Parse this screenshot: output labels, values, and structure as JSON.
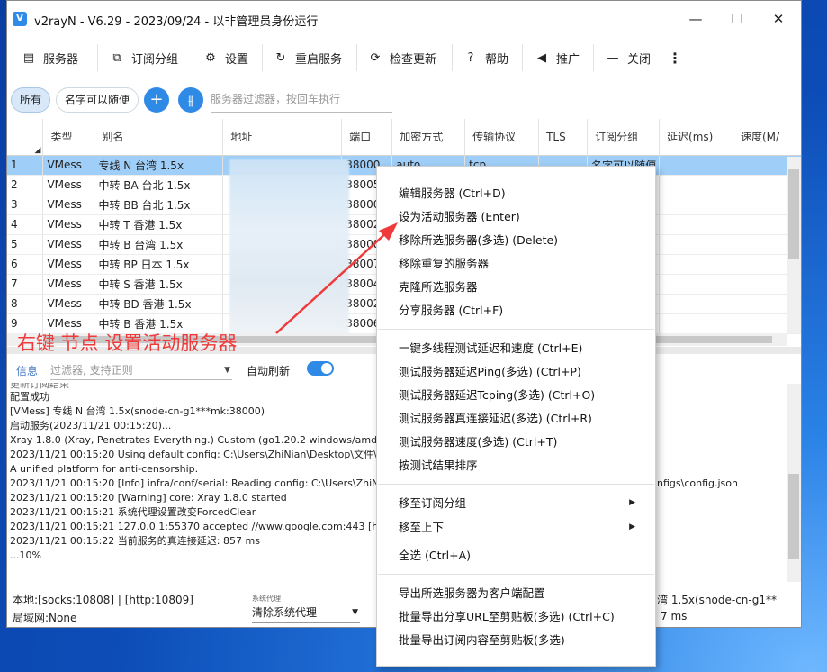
{
  "window": {
    "title": "v2rayN - V6.29 - 2023/09/24 - 以非管理员身份运行",
    "controls": [
      "—",
      "☐",
      "✕"
    ]
  },
  "toolbar": {
    "items": [
      {
        "icon": "server-icon",
        "glyph": "▤",
        "label": "服务器"
      },
      {
        "icon": "subscription-icon",
        "glyph": "⧉",
        "label": "订阅分组"
      },
      {
        "icon": "gear-icon",
        "glyph": "⚙",
        "label": "设置"
      },
      {
        "icon": "restart-icon",
        "glyph": "↻",
        "label": "重启服务"
      },
      {
        "icon": "update-icon",
        "glyph": "⟳",
        "label": "检查更新"
      },
      {
        "icon": "help-icon",
        "glyph": "?",
        "label": "帮助"
      },
      {
        "icon": "promote-icon",
        "glyph": "◀",
        "label": "推广"
      },
      {
        "icon": "close-icon",
        "glyph": "—",
        "label": "关闭"
      }
    ],
    "more": "⋮"
  },
  "filterbar": {
    "chips": [
      "所有",
      "名字可以随便"
    ],
    "search_placeholder": "服务器过滤器，按回车执行"
  },
  "grid": {
    "columns": [
      "",
      "类型",
      "别名",
      "地址",
      "端口",
      "加密方式",
      "传输协议",
      "TLS",
      "订阅分组",
      "延迟(ms)",
      "速度(M/"
    ],
    "rows": [
      {
        "n": "1",
        "type": "VMess",
        "alias": "专线 N 台湾 1.5x",
        "port": "38000",
        "security": "auto",
        "network": "tcp",
        "tls": "",
        "sub": "名字可以随便"
      },
      {
        "n": "2",
        "type": "VMess",
        "alias": "中转 BA 台北 1.5x",
        "port": "38005",
        "security": "",
        "network": "",
        "tls": "",
        "sub": ""
      },
      {
        "n": "3",
        "type": "VMess",
        "alias": "中转 BB 台北 1.5x",
        "port": "38000",
        "security": "",
        "network": "",
        "tls": "",
        "sub": ""
      },
      {
        "n": "4",
        "type": "VMess",
        "alias": "中转 T 香港 1.5x",
        "port": "38002",
        "security": "",
        "network": "",
        "tls": "",
        "sub": ""
      },
      {
        "n": "5",
        "type": "VMess",
        "alias": "中转 B 台湾 1.5x",
        "port": "38008",
        "security": "",
        "network": "",
        "tls": "",
        "sub": ""
      },
      {
        "n": "6",
        "type": "VMess",
        "alias": "中转 BP 日本 1.5x",
        "port": "38007",
        "security": "",
        "network": "",
        "tls": "",
        "sub": ""
      },
      {
        "n": "7",
        "type": "VMess",
        "alias": "中转 S 香港 1.5x",
        "port": "38004",
        "security": "",
        "network": "",
        "tls": "",
        "sub": ""
      },
      {
        "n": "8",
        "type": "VMess",
        "alias": "中转 BD 香港 1.5x",
        "port": "38002",
        "security": "",
        "network": "",
        "tls": "",
        "sub": ""
      },
      {
        "n": "9",
        "type": "VMess",
        "alias": "中转 B 香港 1.5x",
        "port": "38006",
        "security": "",
        "network": "",
        "tls": "",
        "sub": ""
      }
    ]
  },
  "log": {
    "tab": "信息",
    "filter_placeholder": "过滤器, 支持正则",
    "auto_refresh": "自动刷新",
    "cut_line": "更新订阅结束",
    "lines": [
      "配置成功",
      "[VMess] 专线 N 台湾 1.5x(snode-cn-g1***mk:38000)",
      "启动服务(2023/11/21 00:15:20)...",
      "Xray 1.8.0 (Xray, Penetrates Everything.) Custom (go1.20.2 windows/amd64)",
      "2023/11/21 00:15:20 Using default config:  C:\\Users\\ZhiNian\\Desktop\\文件\\v2r",
      "A unified platform for anti-censorship.",
      "2023/11/21 00:15:20 [Info] infra/conf/serial: Reading config: C:\\Users\\ZhiNian\\",
      "2023/11/21 00:15:20 [Warning] core: Xray 1.8.0 started",
      "2023/11/21 00:15:21 系统代理设置改变ForcedClear",
      "2023/11/21 00:15:21 127.0.0.1:55370 accepted //www.google.com:443 [http >>",
      "2023/11/21 00:15:22 当前服务的真连接延迟: 857 ms",
      "...10%"
    ],
    "tail_text": "nfigs\\config.json"
  },
  "status": {
    "local": "本地:[socks:10808] | [http:10809]",
    "lan": "局域网:None",
    "proxy_label": "系统代理",
    "proxy_value": "清除系统代理",
    "server_tail": "湾 1.5x(snode-cn-g1**",
    "delay_tail": "7 ms"
  },
  "context_menu": {
    "group1": [
      "编辑服务器 (Ctrl+D)",
      "设为活动服务器 (Enter)",
      "移除所选服务器(多选) (Delete)",
      "移除重复的服务器",
      "克隆所选服务器",
      "分享服务器 (Ctrl+F)"
    ],
    "group2": [
      "一键多线程测试延迟和速度 (Ctrl+E)",
      "测试服务器延迟Ping(多选) (Ctrl+P)",
      "测试服务器延迟Tcping(多选) (Ctrl+O)",
      "测试服务器真连接延迟(多选) (Ctrl+R)",
      "测试服务器速度(多选) (Ctrl+T)",
      "按测试结果排序"
    ],
    "group3": [
      "移至订阅分组",
      "移至上下",
      "全选 (Ctrl+A)"
    ],
    "group4": [
      "导出所选服务器为客户端配置",
      "批量导出分享URL至剪贴板(多选) (Ctrl+C)",
      "批量导出订阅内容至剪贴板(多选)"
    ]
  },
  "annotation": "右键 节点 设置活动服务器",
  "colors": {
    "accent": "#2f8ae6",
    "selection": "#9fcff8",
    "annotation": "#ee3a3a"
  }
}
